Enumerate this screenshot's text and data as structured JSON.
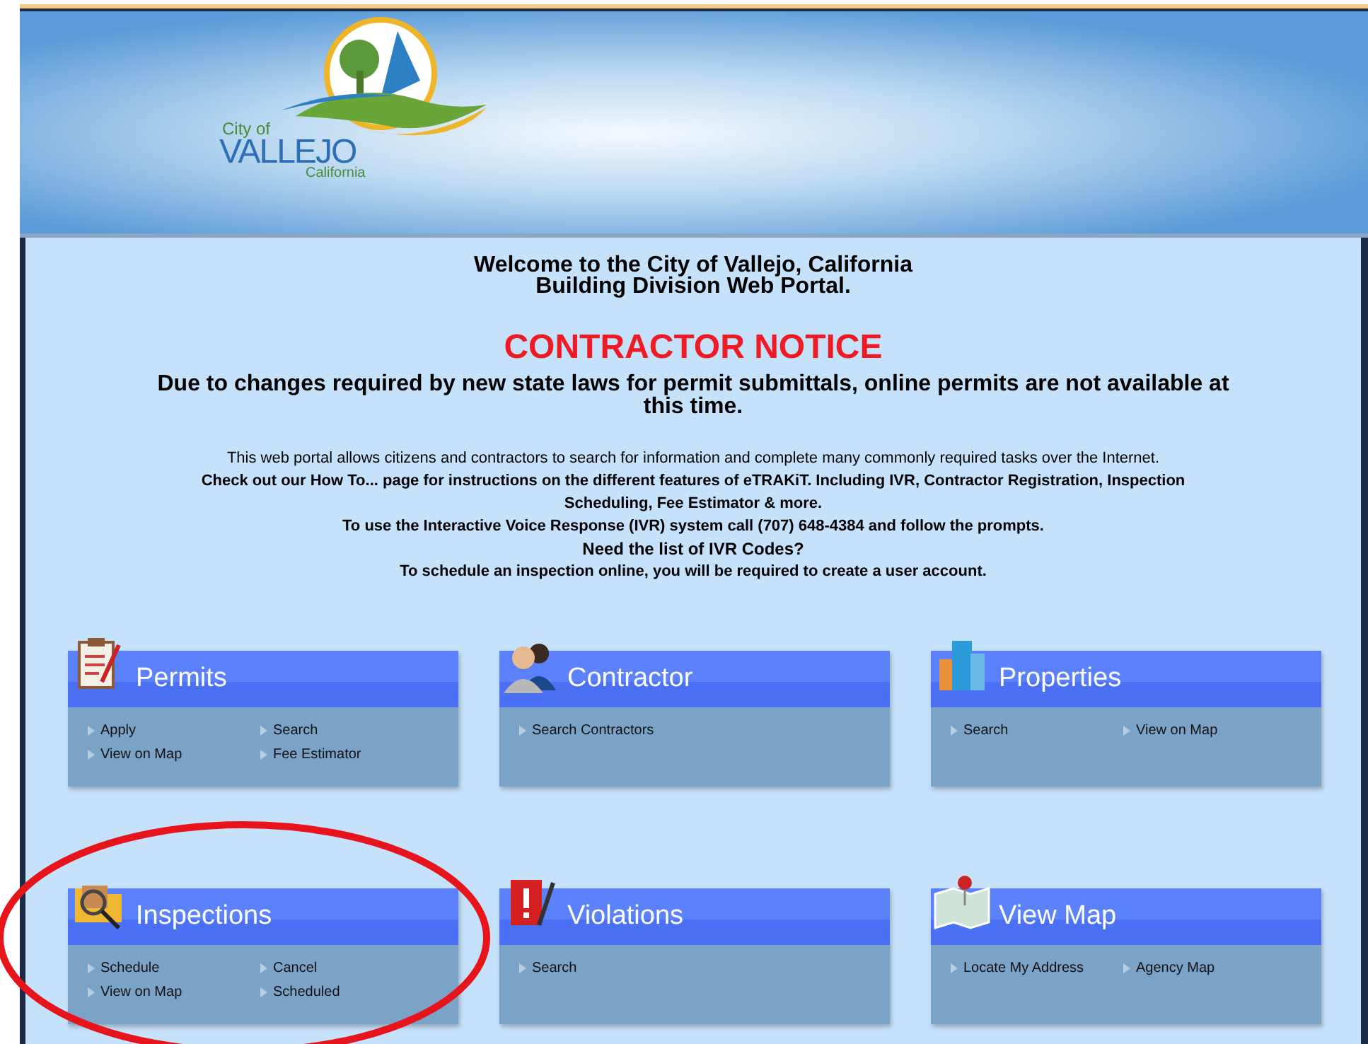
{
  "logo": {
    "city_of": "City of",
    "name": "VALLEJO",
    "state": "California"
  },
  "welcome": [
    "Welcome to the City of Vallejo, California",
    "Building Division Web Portal."
  ],
  "notice": {
    "title": "CONTRACTOR NOTICE",
    "message": "Due to changes required by new state laws for permit submittals, online permits are not available at this time."
  },
  "intro": [
    {
      "text": "This web portal allows citizens and contractors to search for information and complete many commonly required tasks over the Internet.",
      "kind": "plain"
    },
    {
      "text": "Check out our How To... page for instructions on the different features of eTRAKiT. Including IVR, Contractor Registration, Inspection Scheduling, Fee Estimator & more.",
      "kind": "bold"
    },
    {
      "text": "To use the Interactive Voice Response (IVR) system call (707) 648-4384 and follow the prompts.",
      "kind": "bold"
    },
    {
      "text": "Need the list of IVR Codes?",
      "kind": "link"
    },
    {
      "text": "To schedule an inspection online, you will be required to create a user account.",
      "kind": "bold"
    }
  ],
  "cards": [
    {
      "title": "Permits",
      "links": [
        "Apply",
        "Search",
        "View on Map",
        "Fee Estimator"
      ]
    },
    {
      "title": "Contractor",
      "links": [
        "Search Contractors"
      ]
    },
    {
      "title": "Properties",
      "links": [
        "Search",
        "View on Map"
      ]
    },
    {
      "title": "Inspections",
      "links": [
        "Schedule",
        "Cancel",
        "View on Map",
        "Scheduled"
      ]
    },
    {
      "title": "Violations",
      "links": [
        "Search"
      ]
    },
    {
      "title": "View Map",
      "links": [
        "Locate My Address",
        "Agency Map"
      ]
    }
  ]
}
